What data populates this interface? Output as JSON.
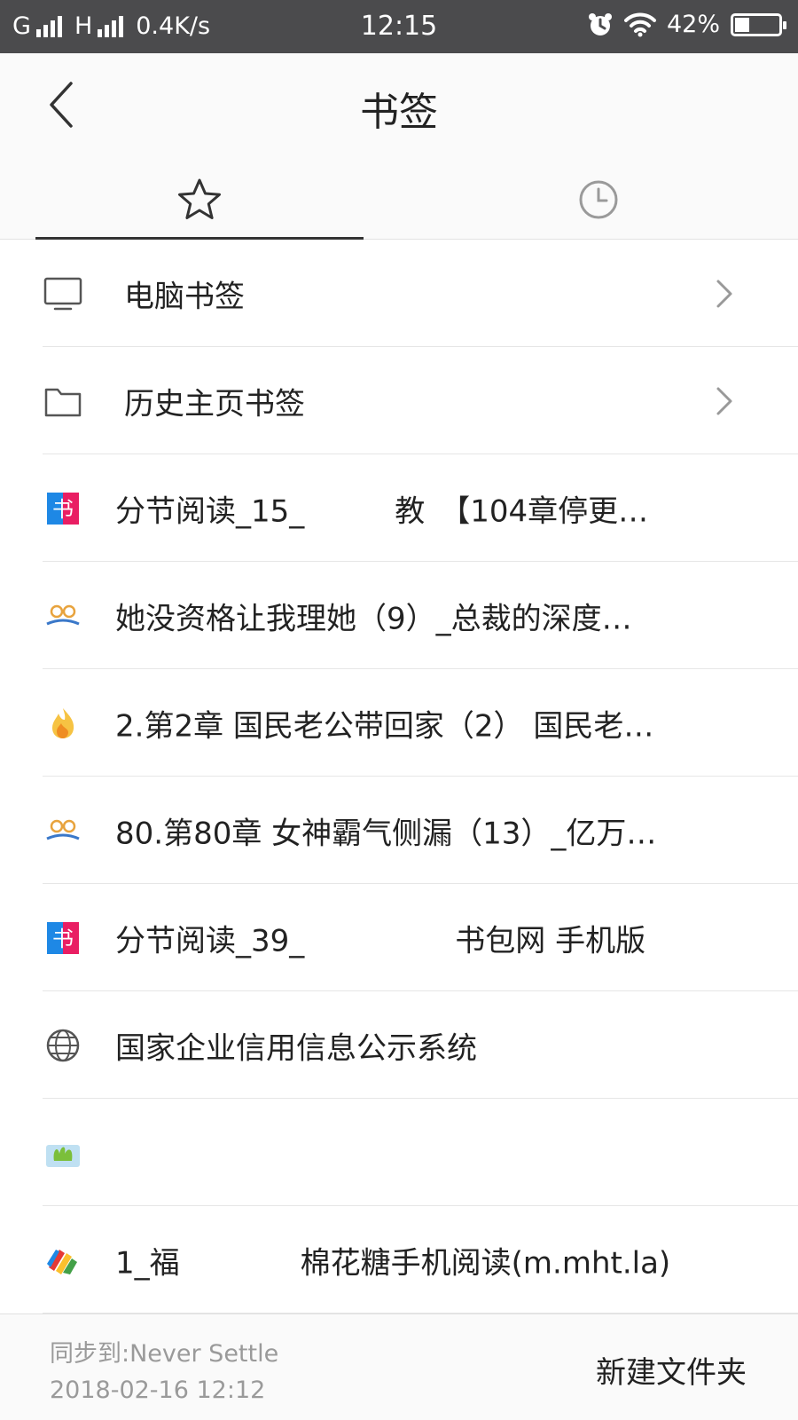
{
  "status_bar": {
    "signal1_label": "G",
    "signal2_label": "H",
    "net_speed": "0.4K/s",
    "time": "12:15",
    "battery": "42%"
  },
  "header": {
    "title": "书签"
  },
  "tabs": [
    {
      "icon": "star-icon",
      "active": true
    },
    {
      "icon": "clock-icon",
      "active": false
    }
  ],
  "folders": [
    {
      "icon": "computer-icon",
      "label": "电脑书签"
    },
    {
      "icon": "folder-icon",
      "label": "历史主页书签"
    }
  ],
  "bookmarks": [
    {
      "icon": "shu-site-icon",
      "label": "分节阅读_15_　　　教　【104章停更…"
    },
    {
      "icon": "book-site-icon",
      "label": "她没资格让我理她（9）_总裁的深度…"
    },
    {
      "icon": "flame-icon",
      "label": "2.第2章 国民老公带回家（2） 国民老…"
    },
    {
      "icon": "book-site-icon",
      "label": "80.第80章 女神霸气侧漏（13）_亿万…"
    },
    {
      "icon": "shu-site-icon",
      "label": "分节阅读_39_　　　　　书包网 手机版"
    },
    {
      "icon": "globe-icon",
      "label": "国家企业信用信息公示系统"
    },
    {
      "icon": "green-site-icon",
      "label": ""
    },
    {
      "icon": "colorful-site-icon",
      "label": "1_福　　　　棉花糖手机阅读(m.mht.la)"
    }
  ],
  "footer": {
    "sync_label": "同步到:Never Settle",
    "sync_time": "2018-02-16 12:12",
    "new_folder_label": "新建文件夹"
  },
  "colors": {
    "status_bar_bg": "#4b4b4d",
    "header_bg": "#fafafa",
    "divider": "#e6e6e6",
    "muted_text": "#9a9a9a"
  }
}
